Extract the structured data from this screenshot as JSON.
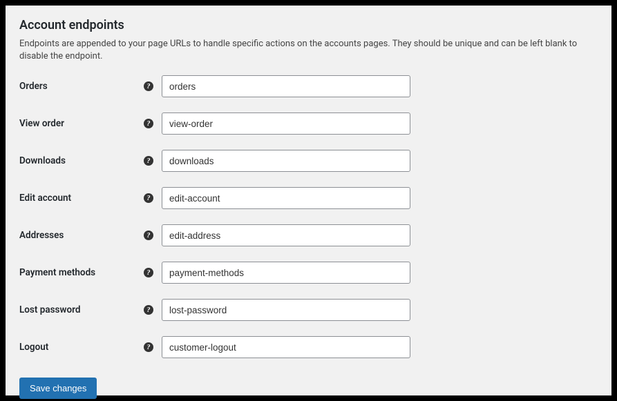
{
  "section": {
    "title": "Account endpoints",
    "description": "Endpoints are appended to your page URLs to handle specific actions on the accounts pages. They should be unique and can be left blank to disable the endpoint."
  },
  "fields": [
    {
      "label": "Orders",
      "value": "orders"
    },
    {
      "label": "View order",
      "value": "view-order"
    },
    {
      "label": "Downloads",
      "value": "downloads"
    },
    {
      "label": "Edit account",
      "value": "edit-account"
    },
    {
      "label": "Addresses",
      "value": "edit-address"
    },
    {
      "label": "Payment methods",
      "value": "payment-methods"
    },
    {
      "label": "Lost password",
      "value": "lost-password"
    },
    {
      "label": "Logout",
      "value": "customer-logout"
    }
  ],
  "actions": {
    "save_label": "Save changes"
  }
}
